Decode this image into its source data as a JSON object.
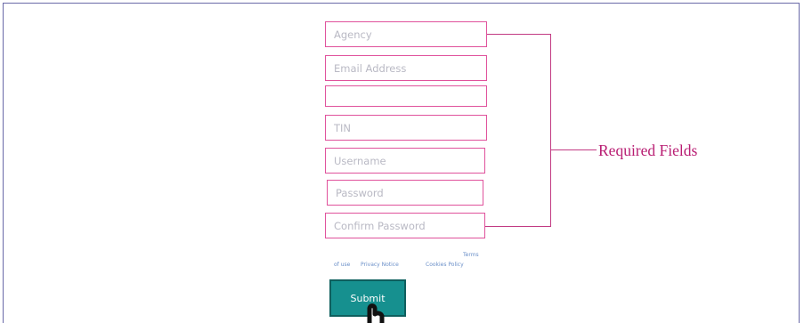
{
  "form": {
    "fields": [
      {
        "placeholder": "Agency",
        "value": ""
      },
      {
        "placeholder": "Email Address",
        "value": ""
      },
      {
        "placeholder": "",
        "value": ""
      },
      {
        "placeholder": "TIN",
        "value": ""
      },
      {
        "placeholder": "Username",
        "value": ""
      },
      {
        "placeholder": "Password",
        "value": ""
      },
      {
        "placeholder": "Confirm Password",
        "value": ""
      }
    ],
    "links": {
      "terms_line1": "Terms",
      "terms_line2": "of use",
      "privacy_notice": "Privacy Notice",
      "cookies_policy": "Cookies Policy"
    },
    "submit_label": "Submit"
  },
  "annotation": {
    "label": "Required Fields",
    "color": "#b81c72"
  },
  "colors": {
    "field_border": "#e0529c",
    "button_bg": "#16908f",
    "link": "#6a8fc8",
    "frame_border": "#6a6aa8"
  }
}
